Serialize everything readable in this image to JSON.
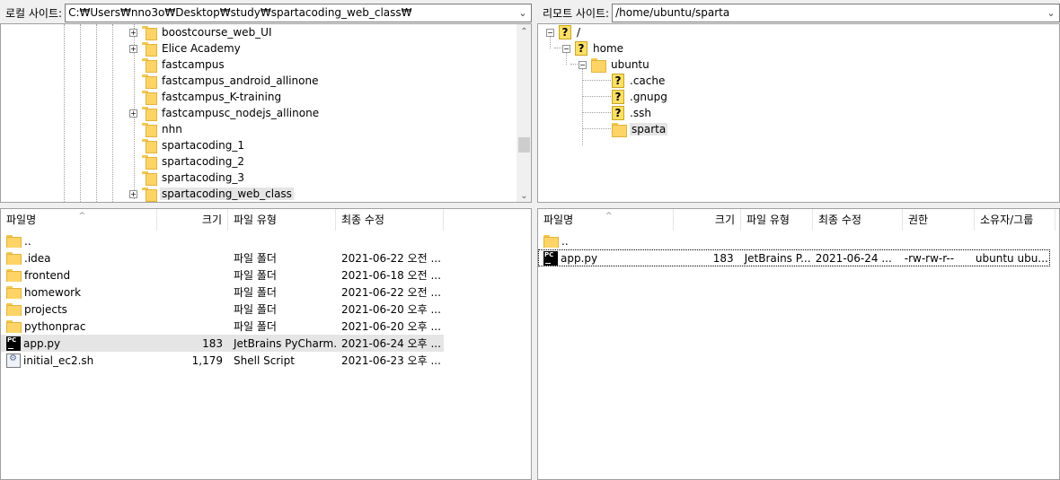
{
  "local": {
    "label": "로컬 사이트:",
    "path": "C:₩Users₩nno3o₩Desktop₩study₩spartacoding_web_class₩",
    "tree": [
      {
        "name": "boostcourse_web_UI",
        "expandable": true
      },
      {
        "name": "Elice Academy",
        "expandable": true
      },
      {
        "name": "fastcampus",
        "expandable": false
      },
      {
        "name": "fastcampus_android_allinone",
        "expandable": false
      },
      {
        "name": "fastcampus_K-training",
        "expandable": false
      },
      {
        "name": "fastcampusc_nodejs_allinone",
        "expandable": true
      },
      {
        "name": "nhn",
        "expandable": false
      },
      {
        "name": "spartacoding_1",
        "expandable": false
      },
      {
        "name": "spartacoding_2",
        "expandable": false
      },
      {
        "name": "spartacoding_3",
        "expandable": false
      },
      {
        "name": "spartacoding_web_class",
        "expandable": true,
        "selected": true
      }
    ],
    "columns": {
      "name": "파일명",
      "size": "크기",
      "type": "파일 유형",
      "modified": "최종 수정"
    },
    "files": [
      {
        "name": "..",
        "size": "",
        "type": "",
        "modified": "",
        "icon": "folder-icon"
      },
      {
        "name": ".idea",
        "size": "",
        "type": "파일 폴더",
        "modified": "2021-06-22 오전 ...",
        "icon": "folder-icon"
      },
      {
        "name": "frontend",
        "size": "",
        "type": "파일 폴더",
        "modified": "2021-06-18 오전 ...",
        "icon": "folder-icon"
      },
      {
        "name": "homework",
        "size": "",
        "type": "파일 폴더",
        "modified": "2021-06-22 오전 ...",
        "icon": "folder-icon"
      },
      {
        "name": "projects",
        "size": "",
        "type": "파일 폴더",
        "modified": "2021-06-20 오후 ...",
        "icon": "folder-icon"
      },
      {
        "name": "pythonprac",
        "size": "",
        "type": "파일 폴더",
        "modified": "2021-06-20 오후 ...",
        "icon": "folder-icon"
      },
      {
        "name": "app.py",
        "size": "183",
        "type": "JetBrains PyCharm...",
        "modified": "2021-06-24 오후 ...",
        "icon": "pycharm-file-icon",
        "selected": true
      },
      {
        "name": "initial_ec2.sh",
        "size": "1,179",
        "type": "Shell Script",
        "modified": "2021-06-23 오후 ...",
        "icon": "shell-script-icon"
      }
    ]
  },
  "remote": {
    "label": "리모트 사이트:",
    "path": "/home/ubuntu/sparta",
    "tree": {
      "root": "/",
      "home": "home",
      "ubuntu": "ubuntu",
      "children": [
        ".cache",
        ".gnupg",
        ".ssh"
      ],
      "current": "sparta"
    },
    "columns": {
      "name": "파일명",
      "size": "크기",
      "type": "파일 유형",
      "modified": "최종 수정",
      "perm": "권한",
      "owner": "소유자/그룹"
    },
    "files": [
      {
        "name": "..",
        "size": "",
        "type": "",
        "modified": "",
        "perm": "",
        "owner": "",
        "icon": "folder-icon"
      },
      {
        "name": "app.py",
        "size": "183",
        "type": "JetBrains P...",
        "modified": "2021-06-24 ...",
        "perm": "-rw-rw-r--",
        "owner": "ubuntu ubu...",
        "icon": "pycharm-file-icon",
        "focused": true
      }
    ]
  }
}
